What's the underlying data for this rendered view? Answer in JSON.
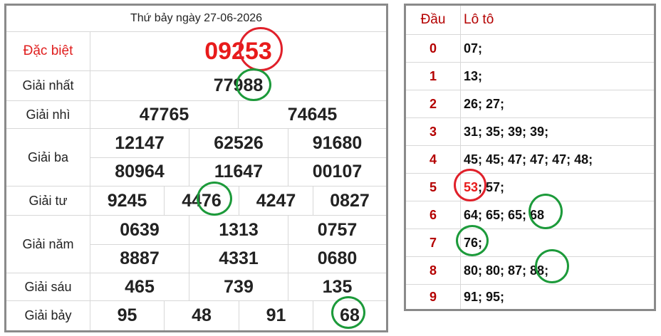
{
  "left": {
    "title": "Thứ bảy ngày 27-06-2026",
    "rows": [
      {
        "label": "Đặc biệt",
        "values": [
          "09253"
        ]
      },
      {
        "label": "Giải nhất",
        "values": [
          "77988"
        ]
      },
      {
        "label": "Giải nhì",
        "values": [
          "47765",
          "74645"
        ]
      },
      {
        "label": "Giải ba",
        "values": [
          "12147",
          "62526",
          "91680",
          "80964",
          "11647",
          "00107"
        ]
      },
      {
        "label": "Giải tư",
        "values": [
          "9245",
          "4476",
          "4247",
          "0827"
        ]
      },
      {
        "label": "Giải năm",
        "values": [
          "0639",
          "1313",
          "0757",
          "8887",
          "4331",
          "0680"
        ]
      },
      {
        "label": "Giải sáu",
        "values": [
          "465",
          "739",
          "135"
        ]
      },
      {
        "label": "Giải bảy",
        "values": [
          "95",
          "48",
          "91",
          "68"
        ]
      }
    ]
  },
  "right": {
    "header": {
      "dau": "Đầu",
      "loto": "Lô tô"
    },
    "rows": [
      {
        "dau": "0",
        "loto": "07;"
      },
      {
        "dau": "1",
        "loto": "13;"
      },
      {
        "dau": "2",
        "loto": "26; 27;"
      },
      {
        "dau": "3",
        "loto": "31; 35; 39; 39;"
      },
      {
        "dau": "4",
        "loto": "45; 45; 47; 47; 47; 48;"
      },
      {
        "dau": "5",
        "loto_parts": [
          "53",
          "; 57;"
        ]
      },
      {
        "dau": "6",
        "loto": "64; 65; 65; 68"
      },
      {
        "dau": "7",
        "loto": "76;"
      },
      {
        "dau": "8",
        "loto": "80; 80; 87; 88;"
      },
      {
        "dau": "9",
        "loto": "91; 95;"
      }
    ]
  },
  "colors": {
    "highlight_green": "#1c9a3a",
    "highlight_red": "#e0202a",
    "special_red": "#e81b1b",
    "dau_red": "#b40000"
  }
}
